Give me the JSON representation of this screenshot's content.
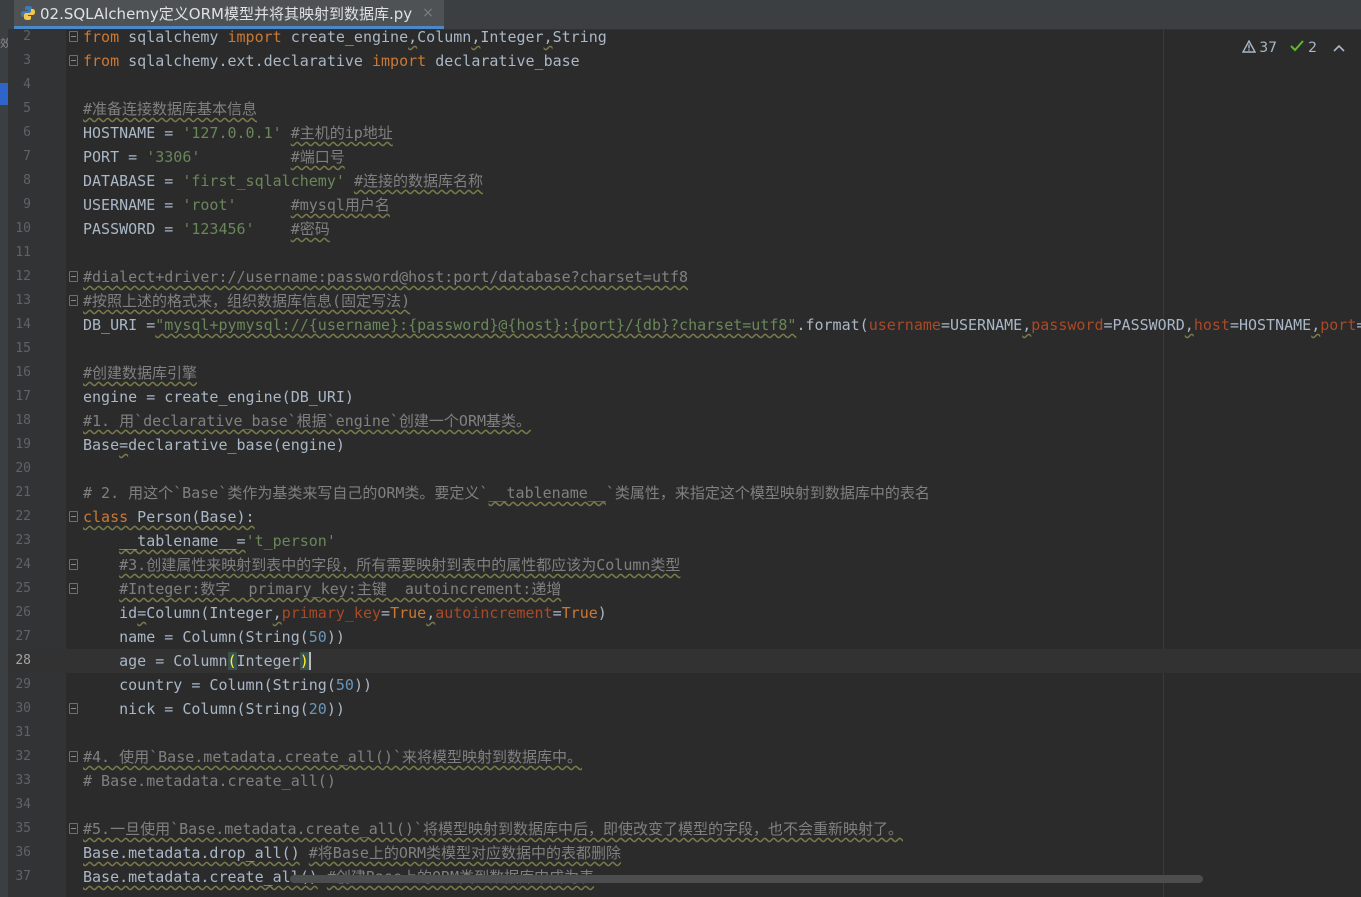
{
  "tab": {
    "filename": "02.SQLAlchemy定义ORM模型并将其映射到数据库.py",
    "close": "×"
  },
  "sidebar_hint": "效",
  "inspections": {
    "warnings": "37",
    "weak_warnings": "2",
    "collapse": "^"
  },
  "current_line": "28",
  "lines": [
    {
      "n": "2"
    },
    {
      "n": "3"
    },
    {
      "n": "4"
    },
    {
      "n": "5"
    },
    {
      "n": "6"
    },
    {
      "n": "7"
    },
    {
      "n": "8"
    },
    {
      "n": "9"
    },
    {
      "n": "10"
    },
    {
      "n": "11"
    },
    {
      "n": "12"
    },
    {
      "n": "13"
    },
    {
      "n": "14"
    },
    {
      "n": "15"
    },
    {
      "n": "16"
    },
    {
      "n": "17"
    },
    {
      "n": "18"
    },
    {
      "n": "19"
    },
    {
      "n": "20"
    },
    {
      "n": "21"
    },
    {
      "n": "22"
    },
    {
      "n": "23"
    },
    {
      "n": "24"
    },
    {
      "n": "25"
    },
    {
      "n": "26"
    },
    {
      "n": "27"
    },
    {
      "n": "28"
    },
    {
      "n": "29"
    },
    {
      "n": "30"
    },
    {
      "n": "31"
    },
    {
      "n": "32"
    },
    {
      "n": "33"
    },
    {
      "n": "34"
    },
    {
      "n": "35"
    },
    {
      "n": "36"
    },
    {
      "n": "37"
    }
  ],
  "colors": {
    "background": "#2b2b2b",
    "keyword": "#cc7832",
    "string": "#6a8759",
    "comment": "#808080",
    "number": "#6897bb",
    "param": "#aa4926"
  }
}
